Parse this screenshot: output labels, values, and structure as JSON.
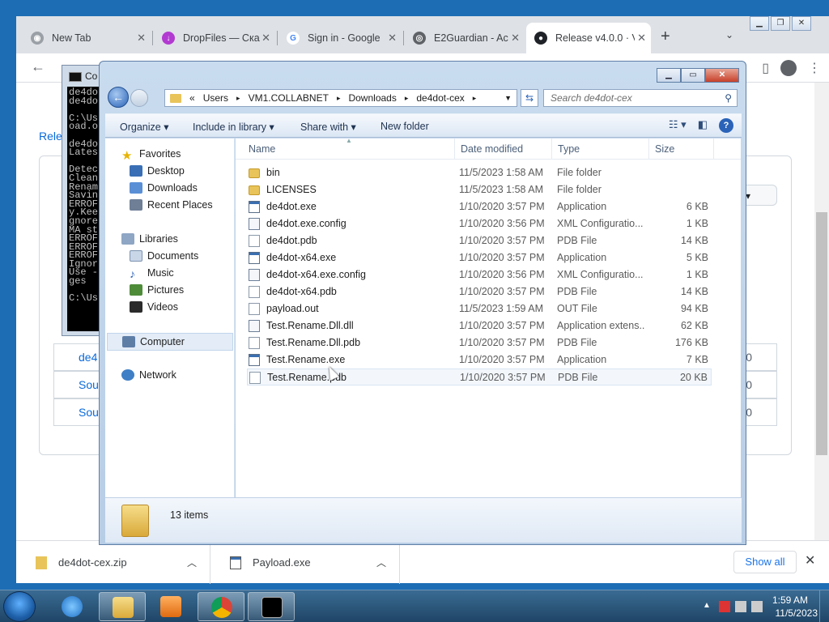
{
  "browser": {
    "tabs": [
      {
        "label": "New Tab",
        "icon": "chrome-icon"
      },
      {
        "label": "DropFiles — Ска",
        "icon": "dropfiles-icon"
      },
      {
        "label": "Sign in - Google",
        "icon": "google-icon"
      },
      {
        "label": "E2Guardian - Ac",
        "icon": "globe-icon"
      },
      {
        "label": "Release v4.0.0 · V",
        "icon": "github-icon"
      }
    ],
    "page": {
      "breadcrumb": "Rele",
      "button_fragment": "e",
      "assets": [
        {
          "label": "de4",
          "year": "020"
        },
        {
          "label": "Sou",
          "year": "020"
        },
        {
          "label": "Sou",
          "year": "020"
        }
      ]
    },
    "downloads": [
      {
        "name": "de4dot-cex.zip"
      },
      {
        "name": "Payload.exe"
      }
    ],
    "show_all": "Show all"
  },
  "cmd": {
    "title": "Co",
    "lines": [
      "de4do",
      "de4do",
      "",
      "C:\\Us",
      "oad.o",
      "",
      "de4do",
      "Lates",
      "",
      "Detec",
      "Clean",
      "Renam",
      "Savin",
      "ERROF",
      "y.Kee",
      "gnore",
      "MA st",
      "ERROF",
      "ERROF",
      "ERROF",
      "Ignor",
      "Use -",
      "ges",
      "",
      "C:\\Us"
    ]
  },
  "explorer": {
    "breadcrumbs": [
      "«",
      "Users",
      "VM1.COLLABNET",
      "Downloads",
      "de4dot-cex"
    ],
    "search_placeholder": "Search de4dot-cex",
    "commands": {
      "organize": "Organize",
      "include": "Include in library",
      "share": "Share with",
      "newfolder": "New folder"
    },
    "nav": {
      "favorites": "Favorites",
      "desktop": "Desktop",
      "downloads": "Downloads",
      "recent": "Recent Places",
      "libraries": "Libraries",
      "documents": "Documents",
      "music": "Music",
      "pictures": "Pictures",
      "videos": "Videos",
      "computer": "Computer",
      "network": "Network"
    },
    "columns": {
      "name": "Name",
      "date": "Date modified",
      "type": "Type",
      "size": "Size"
    },
    "files": [
      {
        "name": "bin",
        "date": "11/5/2023 1:58 AM",
        "type": "File folder",
        "size": "",
        "icon": "folder"
      },
      {
        "name": "LICENSES",
        "date": "11/5/2023 1:58 AM",
        "type": "File folder",
        "size": "",
        "icon": "folder"
      },
      {
        "name": "de4dot.exe",
        "date": "1/10/2020 3:57 PM",
        "type": "Application",
        "size": "6 KB",
        "icon": "app"
      },
      {
        "name": "de4dot.exe.config",
        "date": "1/10/2020 3:56 PM",
        "type": "XML Configuratio...",
        "size": "1 KB",
        "icon": "cfg"
      },
      {
        "name": "de4dot.pdb",
        "date": "1/10/2020 3:57 PM",
        "type": "PDB File",
        "size": "14 KB",
        "icon": "doc"
      },
      {
        "name": "de4dot-x64.exe",
        "date": "1/10/2020 3:57 PM",
        "type": "Application",
        "size": "5 KB",
        "icon": "app"
      },
      {
        "name": "de4dot-x64.exe.config",
        "date": "1/10/2020 3:56 PM",
        "type": "XML Configuratio...",
        "size": "1 KB",
        "icon": "cfg"
      },
      {
        "name": "de4dot-x64.pdb",
        "date": "1/10/2020 3:57 PM",
        "type": "PDB File",
        "size": "14 KB",
        "icon": "doc"
      },
      {
        "name": "payload.out",
        "date": "11/5/2023 1:59 AM",
        "type": "OUT File",
        "size": "94 KB",
        "icon": "doc"
      },
      {
        "name": "Test.Rename.Dll.dll",
        "date": "1/10/2020 3:57 PM",
        "type": "Application extens...",
        "size": "62 KB",
        "icon": "cfg"
      },
      {
        "name": "Test.Rename.Dll.pdb",
        "date": "1/10/2020 3:57 PM",
        "type": "PDB File",
        "size": "176 KB",
        "icon": "doc"
      },
      {
        "name": "Test.Rename.exe",
        "date": "1/10/2020 3:57 PM",
        "type": "Application",
        "size": "7 KB",
        "icon": "app"
      },
      {
        "name": "Test.Rename.pdb",
        "date": "1/10/2020 3:57 PM",
        "type": "PDB File",
        "size": "20 KB",
        "icon": "doc"
      }
    ],
    "item_count": "13 items"
  },
  "taskbar": {
    "time": "1:59 AM",
    "date": "11/5/2023"
  },
  "colors": {
    "desktop": "#1c6db4",
    "link": "#0969da",
    "accent": "#1a73e8"
  }
}
